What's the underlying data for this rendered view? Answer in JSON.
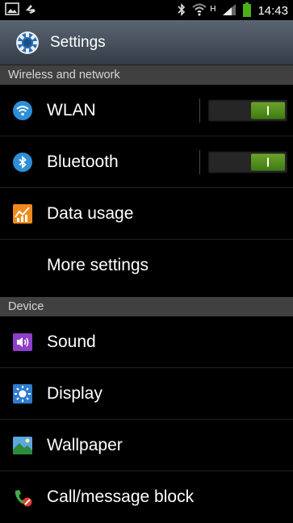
{
  "status_bar": {
    "time": "14:43",
    "network_type": "H",
    "icons": [
      "gallery-icon",
      "usb-debug-icon",
      "bluetooth-icon",
      "wifi-icon",
      "signal-icon",
      "battery-icon"
    ]
  },
  "title_bar": {
    "title": "Settings",
    "icon": "settings-gear-icon"
  },
  "sections": {
    "wireless": "Wireless and network",
    "device": "Device"
  },
  "items": {
    "wlan": {
      "label": "WLAN",
      "icon": "wifi-icon",
      "toggle_on": true
    },
    "bluetooth": {
      "label": "Bluetooth",
      "icon": "bluetooth-icon",
      "toggle_on": true
    },
    "data_usage": {
      "label": "Data usage",
      "icon": "data-usage-icon"
    },
    "more_settings": {
      "label": "More settings"
    },
    "sound": {
      "label": "Sound",
      "icon": "sound-icon"
    },
    "display": {
      "label": "Display",
      "icon": "display-icon"
    },
    "wallpaper": {
      "label": "Wallpaper",
      "icon": "wallpaper-icon"
    },
    "call_block": {
      "label": "Call/message block",
      "icon": "call-block-icon"
    }
  },
  "colors": {
    "toggle_on": "#5a9a22",
    "header_gradient_top": "#5b6572",
    "section_bg": "#404040"
  }
}
